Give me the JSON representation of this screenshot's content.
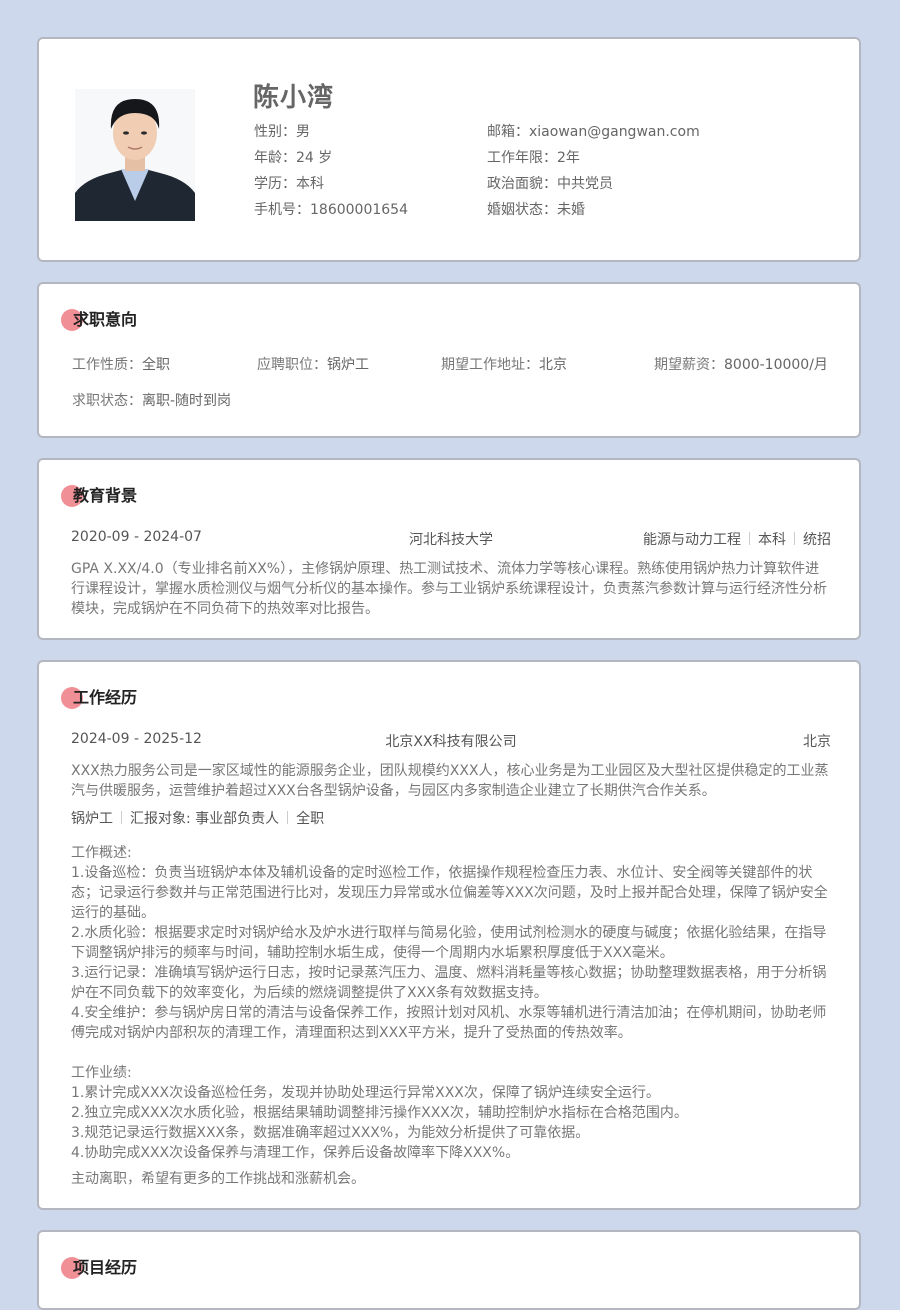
{
  "profile": {
    "name": "陈小湾",
    "gender_label": "性别：",
    "gender": "男",
    "age_label": "年龄：",
    "age": "24 岁",
    "education_label": "学历：",
    "education": "本科",
    "phone_label": "手机号：",
    "phone": "18600001654",
    "email_label": "邮箱：",
    "email": "xiaowan@gangwan.com",
    "years_label": "工作年限：",
    "years": "2年",
    "politics_label": "政治面貌：",
    "politics": "中共党员",
    "marital_label": "婚姻状态：",
    "marital": "未婚"
  },
  "intent": {
    "title": "求职意向",
    "type_label": "工作性质：",
    "type": "全职",
    "position_label": "应聘职位：",
    "position": "锅炉工",
    "location_label": "期望工作地址：",
    "location": "北京",
    "salary_label": "期望薪资：",
    "salary": "8000-10000/月",
    "status_label": "求职状态：",
    "status": "离职-随时到岗"
  },
  "education": {
    "title": "教育背景",
    "period": "2020-09 - 2024-07",
    "school": "河北科技大学",
    "major": "能源与动力工程",
    "degree": "本科",
    "admission": "统招",
    "description": "GPA X.XX/4.0（专业排名前XX%），主修锅炉原理、热工测试技术、流体力学等核心课程。熟练使用锅炉热力计算软件进行课程设计，掌握水质检测仪与烟气分析仪的基本操作。参与工业锅炉系统课程设计，负责蒸汽参数计算与运行经济性分析模块，完成锅炉在不同负荷下的热效率对比报告。"
  },
  "work": {
    "title": "工作经历",
    "period": "2024-09 - 2025-12",
    "company": "北京XX科技有限公司",
    "city": "北京",
    "company_desc": "XXX热力服务公司是一家区域性的能源服务企业，团队规模约XXX人，核心业务是为工业园区及大型社区提供稳定的工业蒸汽与供暖服务，运营维护着超过XXX台各型锅炉设备，与园区内多家制造企业建立了长期供汽合作关系。",
    "role": "锅炉工",
    "report_to": "汇报对象: 事业部负责人",
    "job_type": "全职",
    "duties_heading": "工作概述:",
    "duties": [
      "1.设备巡检：负责当班锅炉本体及辅机设备的定时巡检工作，依据操作规程检查压力表、水位计、安全阀等关键部件的状态；记录运行参数并与正常范围进行比对，发现压力异常或水位偏差等XXX次问题，及时上报并配合处理，保障了锅炉安全运行的基础。",
      "2.水质化验：根据要求定时对锅炉给水及炉水进行取样与简易化验，使用试剂检测水的硬度与碱度；依据化验结果，在指导下调整锅炉排污的频率与时间，辅助控制水垢生成，使得一个周期内水垢累积厚度低于XXX毫米。",
      "3.运行记录：准确填写锅炉运行日志，按时记录蒸汽压力、温度、燃料消耗量等核心数据；协助整理数据表格，用于分析锅炉在不同负载下的效率变化，为后续的燃烧调整提供了XXX条有效数据支持。",
      "4.安全维护：参与锅炉房日常的清洁与设备保养工作，按照计划对风机、水泵等辅机进行清洁加油；在停机期间，协助老师傅完成对锅炉内部积灰的清理工作，清理面积达到XXX平方米，提升了受热面的传热效率。"
    ],
    "results_heading": "工作业绩:",
    "results": [
      "1.累计完成XXX次设备巡检任务，发现并协助处理运行异常XXX次，保障了锅炉连续安全运行。",
      "2.独立完成XXX次水质化验，根据结果辅助调整排污操作XXX次，辅助控制炉水指标在合格范围内。",
      "3.规范记录运行数据XXX条，数据准确率超过XXX%，为能效分析提供了可靠依据。",
      "4.协助完成XXX次设备保养与清理工作，保养后设备故障率下降XXX%。"
    ],
    "leave_reason": "主动离职，希望有更多的工作挑战和涨薪机会。"
  },
  "project": {
    "title": "项目经历"
  },
  "colors": {
    "background": "#cdd8ec",
    "card_border": "#b4b7bf",
    "accent_dot": "#f08f95"
  }
}
